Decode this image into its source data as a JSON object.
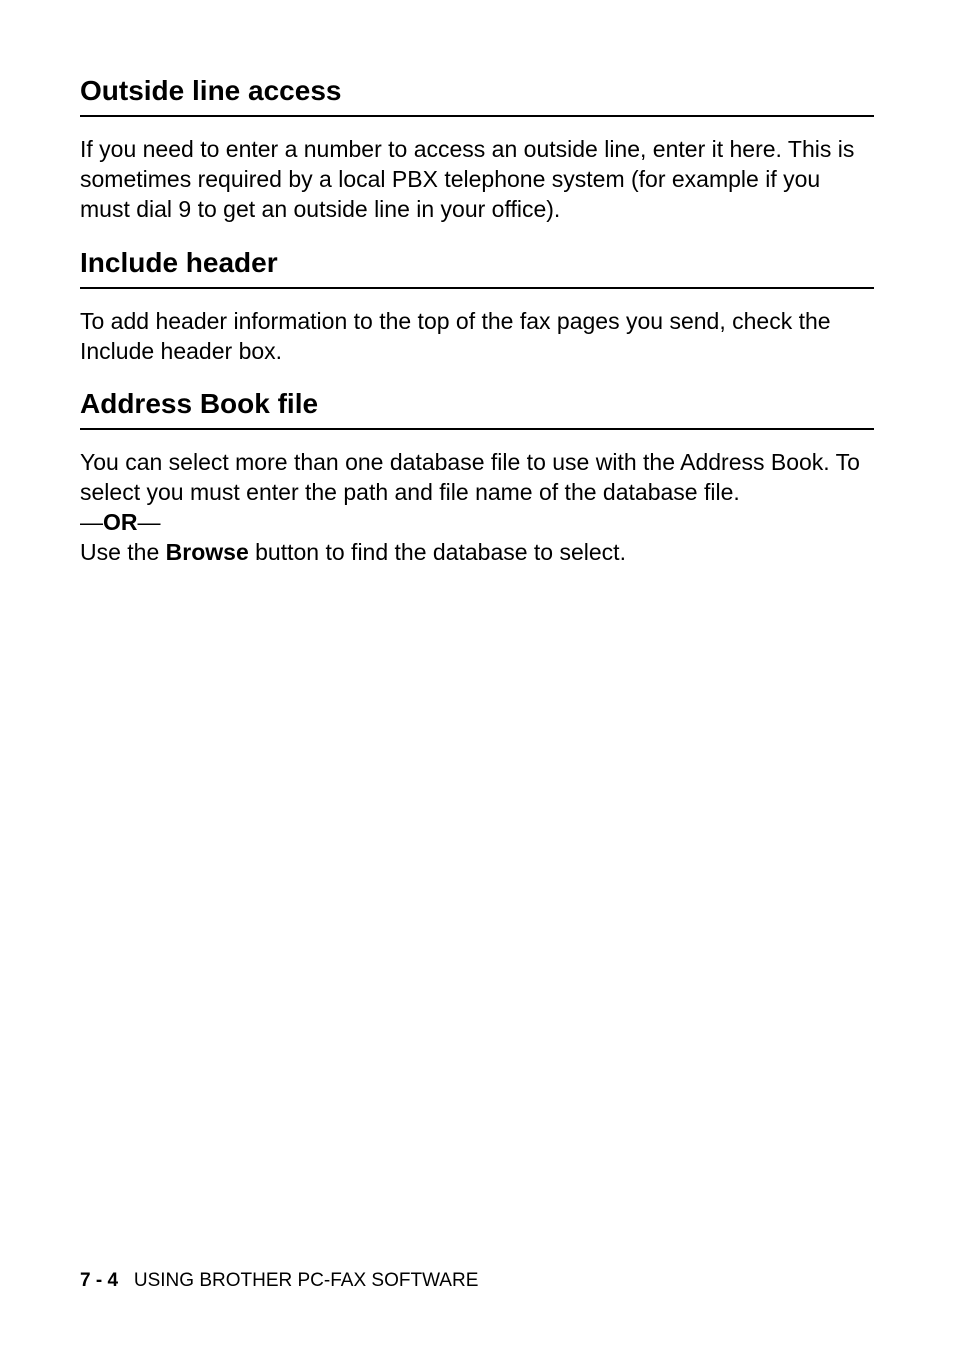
{
  "sections": {
    "s1": {
      "heading": "Outside line access",
      "body": "If you need to enter a number to access an outside line, enter it here. This is sometimes required by a local PBX telephone system (for example if you must dial 9 to get an outside line in your office)."
    },
    "s2": {
      "heading": "Include header",
      "body": "To add header information to the top of the fax pages you send, check the Include header box."
    },
    "s3": {
      "heading": "Address Book file",
      "body": "You can select more than one database file to use with the Address Book. To select you must enter the path and file name of the database file.",
      "or_dash": "—",
      "or_text": "OR",
      "browse_prefix": "Use the ",
      "browse_bold": "Browse",
      "browse_suffix": " button to find the database to select."
    }
  },
  "footer": {
    "page": "7 - 4",
    "title": "USING BROTHER PC-FAX SOFTWARE"
  }
}
